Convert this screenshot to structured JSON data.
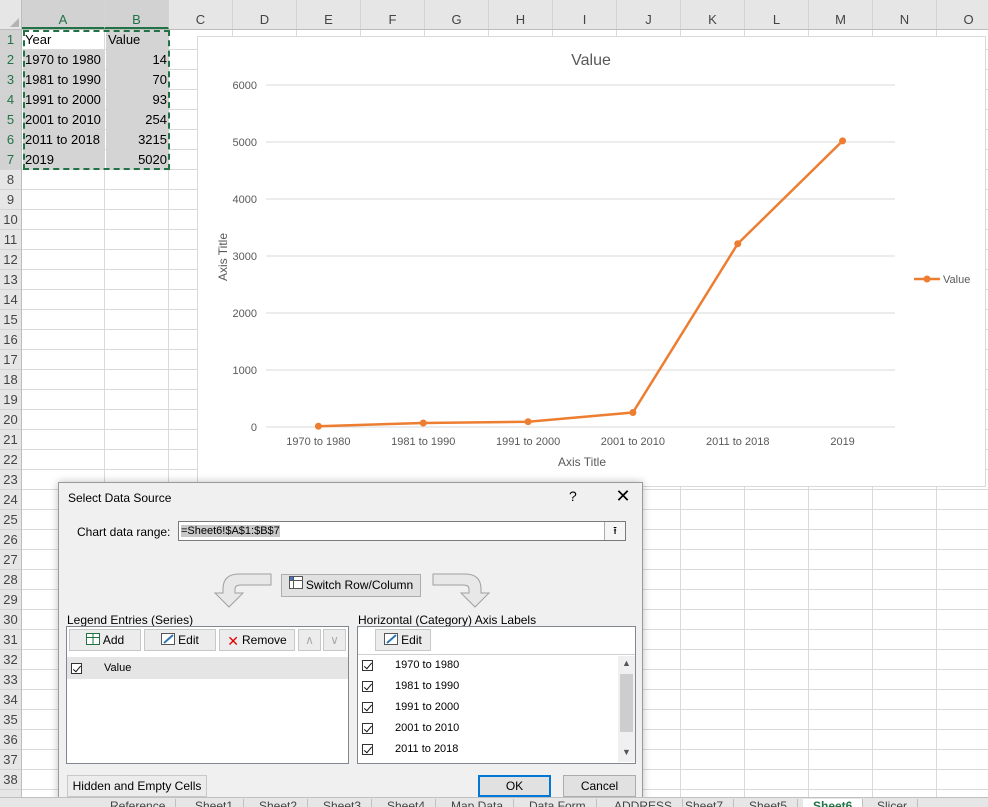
{
  "sheet": {
    "columns": [
      "A",
      "B",
      "C",
      "D",
      "E",
      "F",
      "G",
      "H",
      "I",
      "J",
      "K",
      "L",
      "M",
      "N",
      "O"
    ],
    "rows": [
      "1",
      "2",
      "3",
      "4",
      "5",
      "6",
      "7",
      "8",
      "9",
      "10",
      "11",
      "12",
      "13",
      "14",
      "15",
      "16",
      "17",
      "18",
      "19",
      "20",
      "21",
      "22",
      "23",
      "24",
      "25",
      "26",
      "27",
      "28",
      "29",
      "30",
      "31",
      "32",
      "33",
      "34",
      "35",
      "36",
      "37",
      "38"
    ],
    "table": {
      "headers": [
        "Year",
        "Value"
      ],
      "rows": [
        [
          "1970 to 1980",
          "14"
        ],
        [
          "1981 to 1990",
          "70"
        ],
        [
          "1991 to 2000",
          "93"
        ],
        [
          "2001 to 2010",
          "254"
        ],
        [
          "2011 to 2018",
          "3215"
        ],
        [
          "2019",
          "5020"
        ]
      ]
    }
  },
  "chart_data": {
    "type": "line",
    "title": "Value",
    "xlabel": "Axis Title",
    "ylabel": "Axis Title",
    "categories": [
      "1970 to 1980",
      "1981 to 1990",
      "1991 to 2000",
      "2001 to 2010",
      "2011 to 2018",
      "2019"
    ],
    "series": [
      {
        "name": "Value",
        "values": [
          14,
          70,
          93,
          254,
          3215,
          5020
        ]
      }
    ],
    "ylim": [
      0,
      6000
    ],
    "yticks": [
      "0",
      "1000",
      "2000",
      "3000",
      "4000",
      "5000",
      "6000"
    ],
    "grid": true,
    "legend": "right",
    "series_color": "#ed7d31"
  },
  "dialog": {
    "title": "Select Data Source",
    "help": "?",
    "close": "✕",
    "range_label": "Chart data range:",
    "range_value": "=Sheet6!$A$1:$B$7",
    "switch_label": "Switch Row/Column",
    "legend_label": "Legend Entries (Series)",
    "axis_label": "Horizontal (Category) Axis Labels",
    "add_label": "Add",
    "edit_label": "Edit",
    "remove_label": "Remove",
    "axis_edit_label": "Edit",
    "series_items": [
      "Value"
    ],
    "axis_items": [
      "1970 to 1980",
      "1981 to 1990",
      "1991 to 2000",
      "2001 to 2010",
      "2011 to 2018"
    ],
    "hidden_cells_label": "Hidden and Empty Cells",
    "ok_label": "OK",
    "cancel_label": "Cancel"
  },
  "tabs": [
    "Reference",
    "Sheet1",
    "Sheet2",
    "Sheet3",
    "Sheet4",
    "Map Data",
    "Data Form",
    "ADDRESS",
    "Sheet7",
    "Sheet5",
    "Sheet6",
    "Slicer"
  ],
  "active_tab": "Sheet6",
  "colors": {
    "accent": "#217346",
    "series": "#ed7d31",
    "dialog_default": "#0078d7"
  }
}
